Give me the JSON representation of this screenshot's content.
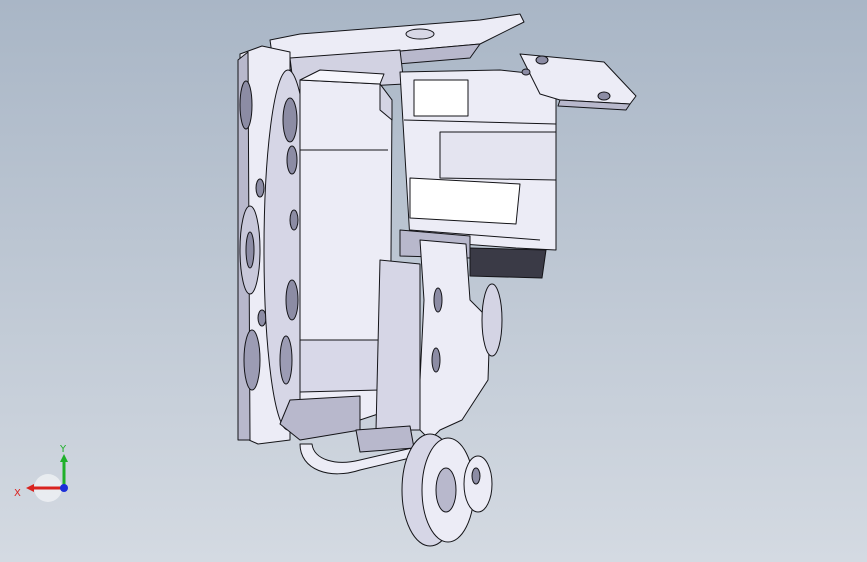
{
  "viewport": {
    "background_top": "#a9b6c6",
    "background_bottom": "#d4dae2",
    "model_fill": "#ececf6",
    "model_shade": "#b8b8cc",
    "model_dark": "#8c8ca4",
    "model_edge": "#141418"
  },
  "triad": {
    "x_label": "X",
    "y_label": "Y",
    "x_color": "#d9231f",
    "y_color": "#1fb02a",
    "z_color": "#1c2fd8"
  }
}
